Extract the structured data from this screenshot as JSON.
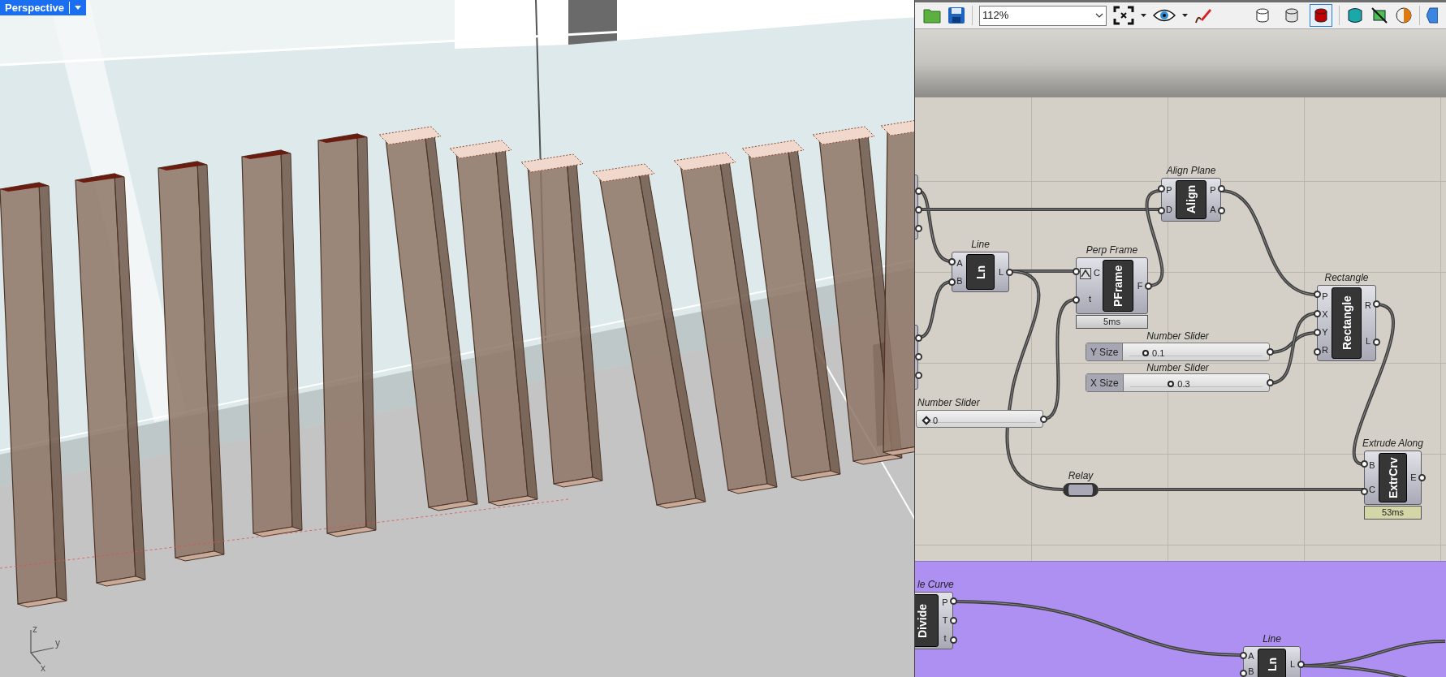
{
  "viewport": {
    "view_label": "Perspective",
    "axes": [
      {
        "label": "z"
      },
      {
        "label": "y"
      },
      {
        "label": "x"
      }
    ]
  },
  "toolbar": {
    "zoom": "112%",
    "preview_buttons": [
      {
        "selected": false
      },
      {
        "selected": false
      },
      {
        "selected": true
      }
    ]
  },
  "canvas": {
    "nodes": [
      {
        "kind": "component",
        "label": "Align Plane",
        "nickname": "Align",
        "inputs": [
          {
            "name": "P",
            "reparameterize": false
          },
          {
            "name": "D",
            "reparameterize": false
          }
        ],
        "outputs": [
          "P",
          "A"
        ]
      },
      {
        "kind": "component",
        "label": "Line",
        "nickname": "Ln",
        "inputs": [
          {
            "name": "A",
            "reparameterize": false
          },
          {
            "name": "B",
            "reparameterize": false
          }
        ],
        "outputs": [
          "L"
        ]
      },
      {
        "kind": "component",
        "label": "Perp Frame",
        "nickname": "PFrame",
        "inputs": [
          {
            "name": "C",
            "reparameterize": true
          },
          {
            "name": "t",
            "reparameterize": false
          }
        ],
        "outputs": [
          "F"
        ],
        "timing": {
          "text": "5ms",
          "highlighted": false
        }
      },
      {
        "kind": "component",
        "label": "Rectangle",
        "nickname": "Rectangle",
        "inputs": [
          {
            "name": "P",
            "reparameterize": false
          },
          {
            "name": "X",
            "reparameterize": false
          },
          {
            "name": "Y",
            "reparameterize": false
          },
          {
            "name": "R",
            "reparameterize": false
          }
        ],
        "outputs": [
          "R",
          "L"
        ]
      },
      {
        "kind": "slider",
        "label": "Number Slider",
        "name": "Y Size",
        "value": "0.1",
        "level": 0.1
      },
      {
        "kind": "slider",
        "label": "Number Slider",
        "name": "X Size",
        "value": "0.3",
        "level": 0.3
      },
      {
        "kind": "slider",
        "label": "Number Slider",
        "value": "0",
        "level": 0
      },
      {
        "kind": "relay",
        "label": "Relay"
      },
      {
        "kind": "component",
        "label": "Extrude Along",
        "nickname": "ExtrCrv",
        "inputs": [
          {
            "name": "B",
            "reparameterize": false
          },
          {
            "name": "C",
            "reparameterize": false
          }
        ],
        "outputs": [
          "E"
        ],
        "timing": {
          "text": "53ms",
          "highlighted": true
        }
      }
    ],
    "group_nodes": [
      {
        "kind": "component",
        "label": "le Curve",
        "nickname": "Divide",
        "outputs": [
          "P",
          "T",
          "t"
        ]
      },
      {
        "kind": "component",
        "label": "Line",
        "nickname": "Ln",
        "inputs": [
          {
            "name": "A",
            "reparameterize": false
          },
          {
            "name": "B",
            "reparameterize": false
          }
        ],
        "outputs": [
          "L"
        ]
      }
    ]
  }
}
